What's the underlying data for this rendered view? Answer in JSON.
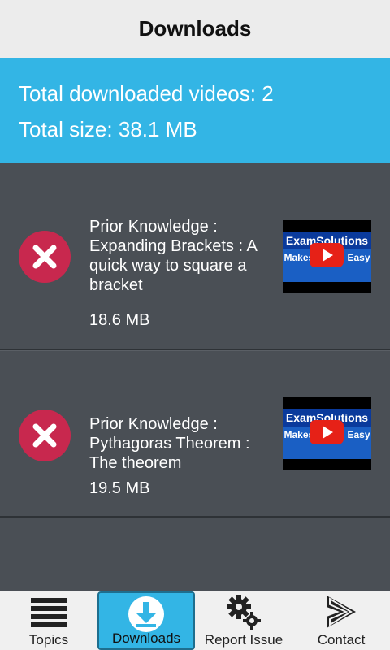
{
  "header": {
    "title": "Downloads"
  },
  "summary": {
    "total_videos": "Total downloaded videos: 2",
    "total_size": "Total size: 38.1 MB"
  },
  "downloads": [
    {
      "title": "Prior Knowledge : Expanding Brackets : A quick way to square a bracket",
      "size": "18.6 MB",
      "thumb_brand": "ExamSolutions",
      "thumb_tag": "Makes Maths Easy"
    },
    {
      "title": "Prior Knowledge : Pythagoras Theorem : The theorem",
      "size": "19.5 MB",
      "thumb_brand": "ExamSolutions",
      "thumb_tag": "Makes Maths Easy"
    }
  ],
  "nav": {
    "items": [
      {
        "label": "Topics",
        "icon": "menu-icon"
      },
      {
        "label": "Downloads",
        "icon": "download-icon"
      },
      {
        "label": "Report Issue",
        "icon": "gears-icon"
      },
      {
        "label": "Contact",
        "icon": "send-icon"
      }
    ],
    "active": "Downloads"
  },
  "colors": {
    "accent": "#33b5e5",
    "delete": "#c8284e",
    "background": "#4a4f55"
  }
}
